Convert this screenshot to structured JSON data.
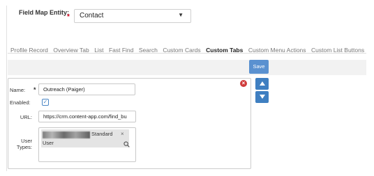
{
  "field_map": {
    "label": "Field Map Entity:",
    "required_mark": "*",
    "selected": "Contact"
  },
  "tabs": [
    {
      "label": "Profile Record"
    },
    {
      "label": "Overview Tab"
    },
    {
      "label": "List"
    },
    {
      "label": "Fast Find"
    },
    {
      "label": "Search"
    },
    {
      "label": "Custom Cards"
    },
    {
      "label": "Custom Tabs",
      "active": true
    },
    {
      "label": "Custom Menu Actions"
    },
    {
      "label": "Custom List Buttons"
    }
  ],
  "toolbar": {
    "save_label": "Save"
  },
  "form": {
    "name_label": "Name:",
    "name_required": "*",
    "name_value": "Outreach (Paiger)",
    "enabled_label": "Enabled:",
    "enabled_checked": true,
    "url_label": "URL:",
    "url_value": "https://crm.content-app.com/find_bu",
    "user_types_label_1": "User",
    "user_types_label_2": "Types:",
    "user_type_chip_line1": "Standard",
    "user_type_chip_line2": "User",
    "chip_remove": "×"
  },
  "colors": {
    "accent": "#5a91d0",
    "nav": "#3f7fc1",
    "required": "#d0021b",
    "remove": "#cf3b3b"
  },
  "icons": [
    "chevron-down-icon",
    "close-circle-icon",
    "check-icon",
    "search-icon",
    "arrow-up-icon",
    "arrow-down-icon"
  ]
}
